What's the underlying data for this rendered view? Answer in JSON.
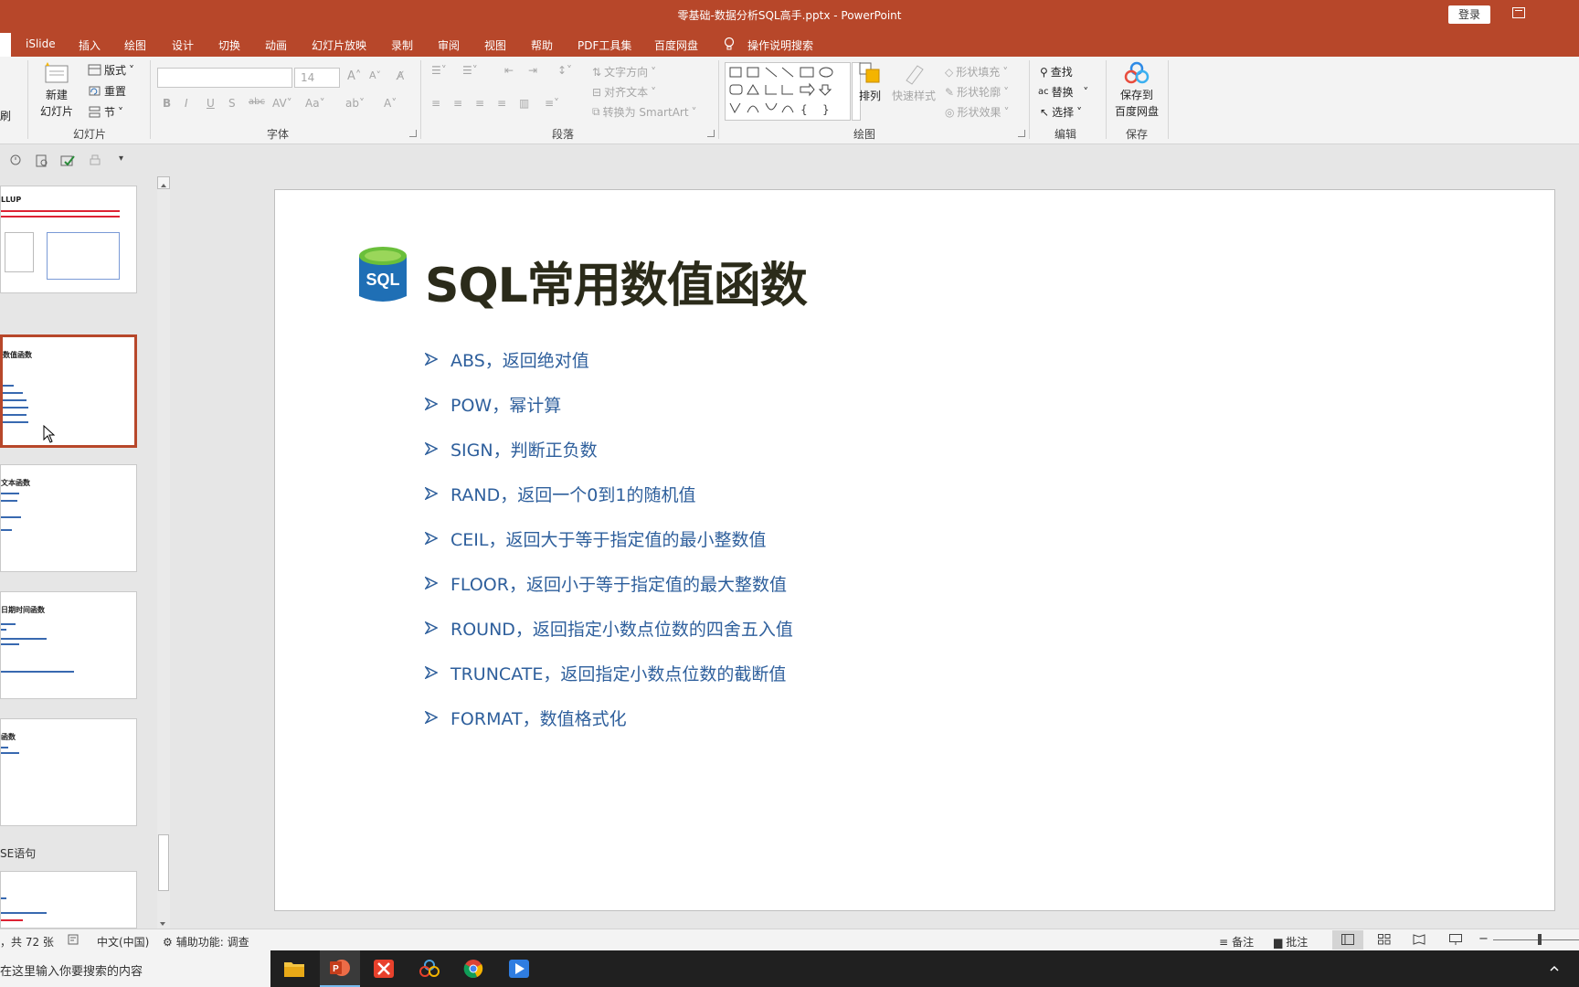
{
  "window": {
    "title": "零基础-数据分析SQL高手.pptx  -  PowerPoint",
    "login_label": "登录"
  },
  "tabs": [
    "iSlide",
    "插入",
    "绘图",
    "设计",
    "切换",
    "动画",
    "幻灯片放映",
    "录制",
    "审阅",
    "视图",
    "帮助",
    "PDF工具集",
    "百度网盘"
  ],
  "tell_me": "操作说明搜索",
  "ribbon": {
    "clipboard_stub": "刷",
    "slides": {
      "new_slide_line1": "新建",
      "new_slide_line2": "幻灯片",
      "layout": "版式",
      "reset": "重置",
      "section": "节",
      "group_label": "幻灯片"
    },
    "font": {
      "size": "14",
      "group_label": "字体"
    },
    "paragraph": {
      "text_direction": "文字方向",
      "align_text": "对齐文本",
      "smartart": "转换为 SmartArt",
      "group_label": "段落"
    },
    "drawing": {
      "arrange": "排列",
      "quick_styles": "快速样式",
      "shape_fill": "形状填充",
      "shape_outline": "形状轮廓",
      "shape_effects": "形状效果",
      "group_label": "绘图"
    },
    "editing": {
      "find": "查找",
      "replace": "替换",
      "select": "选择",
      "group_label": "编辑"
    },
    "save": {
      "line1": "保存到",
      "line2": "百度网盘",
      "group_label": "保存"
    }
  },
  "thumbnails": [
    {
      "title": "LLUP"
    },
    {
      "title": "数值函数"
    },
    {
      "title": "文本函数"
    },
    {
      "title": "日期时间函数"
    },
    {
      "title": "函数"
    }
  ],
  "section_label": "SE语句",
  "slide": {
    "logo_text": "SQL",
    "title": "SQL常用数值函数",
    "bullets": [
      "ABS，返回绝对值",
      "POW，幂计算",
      "SIGN，判断正负数",
      "RAND，返回一个0到1的随机值",
      "CEIL，返回大于等于指定值的最小整数值",
      "FLOOR，返回小于等于指定值的最大整数值",
      "ROUND，返回指定小数点位数的四舍五入值",
      "TRUNCATE，返回指定小数点位数的截断值",
      "FORMAT，数值格式化"
    ]
  },
  "status": {
    "slide_count": "，共 72 张",
    "language": "中文(中国)",
    "accessibility": "辅助功能: 调查",
    "notes": "备注",
    "comments": "批注"
  },
  "taskbar": {
    "search_placeholder": "在这里输入你要搜索的内容"
  },
  "colors": {
    "accent": "#b7472a",
    "bullet_text": "#2e5f9c",
    "title_text": "#2b2b1a"
  }
}
